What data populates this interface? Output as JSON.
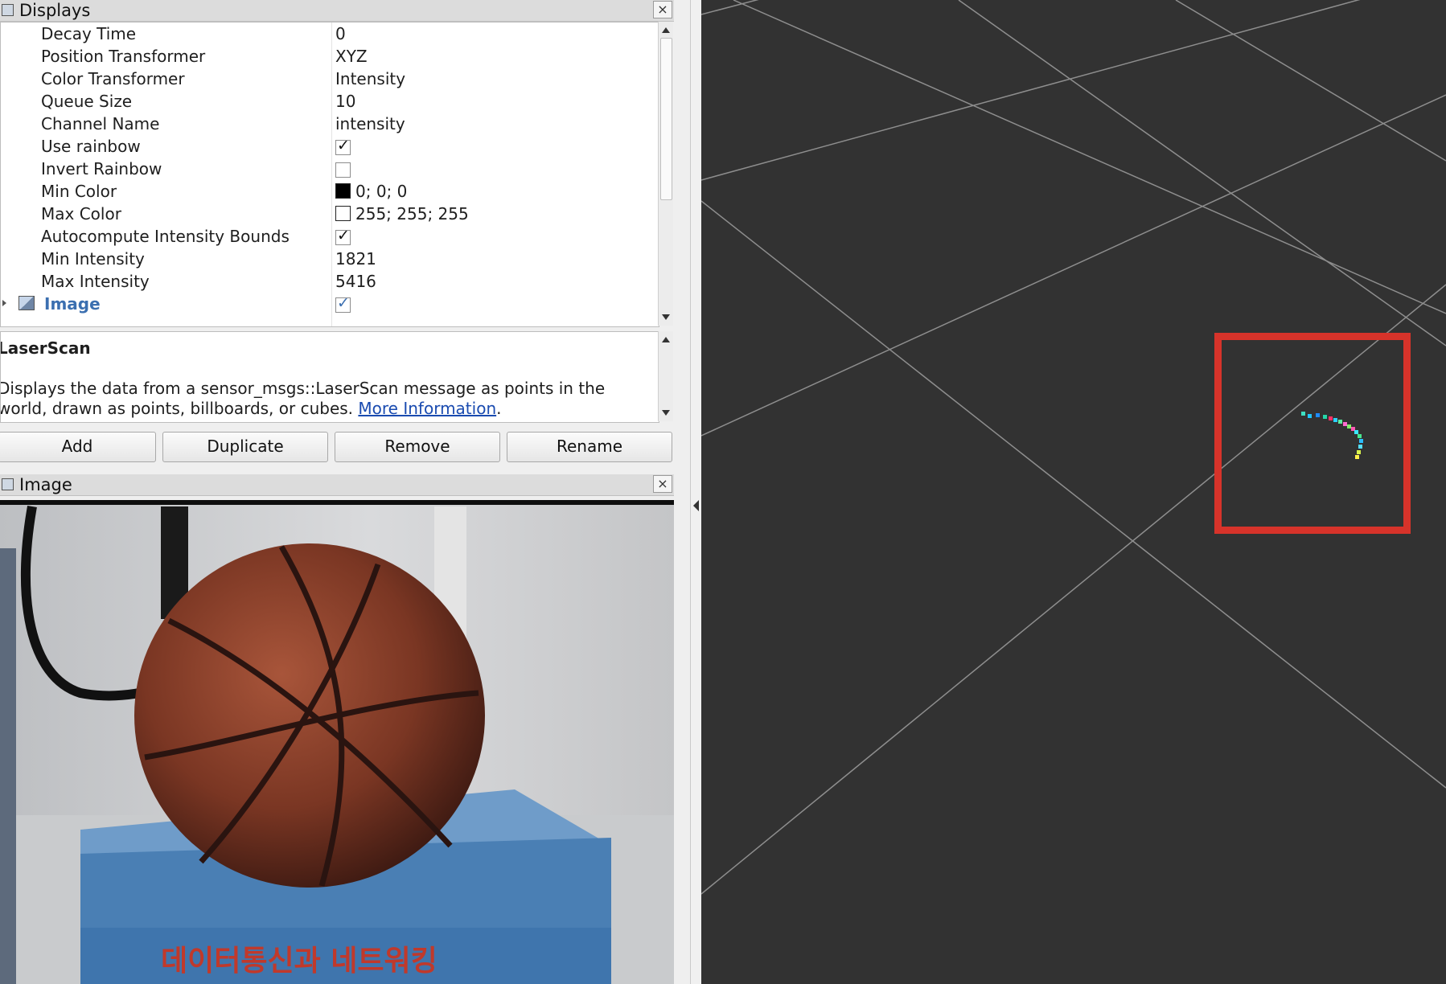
{
  "displays_panel": {
    "title": "Displays",
    "close_label": "×",
    "properties": [
      {
        "name": "Decay Time",
        "value": "0"
      },
      {
        "name": "Position Transformer",
        "value": "XYZ"
      },
      {
        "name": "Color Transformer",
        "value": "Intensity"
      },
      {
        "name": "Queue Size",
        "value": "10"
      },
      {
        "name": "Channel Name",
        "value": "intensity"
      },
      {
        "name": "Use rainbow",
        "checked": true
      },
      {
        "name": "Invert Rainbow",
        "checked": false
      },
      {
        "name": "Min Color",
        "value": "0; 0; 0",
        "color": "#000000"
      },
      {
        "name": "Max Color",
        "value": "255; 255; 255",
        "color": "#ffffff"
      },
      {
        "name": "Autocompute Intensity Bounds",
        "checked": true
      },
      {
        "name": "Min Intensity",
        "value": "1821"
      },
      {
        "name": "Max Intensity",
        "value": "5416"
      }
    ],
    "image_item": {
      "label": "Image",
      "checked": true,
      "color": "#3b6fb0"
    }
  },
  "description": {
    "title": "LaserScan",
    "text_before_link": "Displays the data from a sensor_msgs::LaserScan message as points in the world, drawn as points, billboards, or cubes.",
    "link_text": "More Information",
    "text_after_link": "."
  },
  "buttons": {
    "add": "Add",
    "duplicate": "Duplicate",
    "remove": "Remove",
    "rename": "Rename"
  },
  "image_panel": {
    "title": "Image",
    "close_label": "×",
    "book_text": "데이터통신과 네트워킹"
  },
  "viewport": {
    "background": "#323232",
    "grid_color": "#8e8e8e",
    "highlight_color": "#d7332a"
  }
}
